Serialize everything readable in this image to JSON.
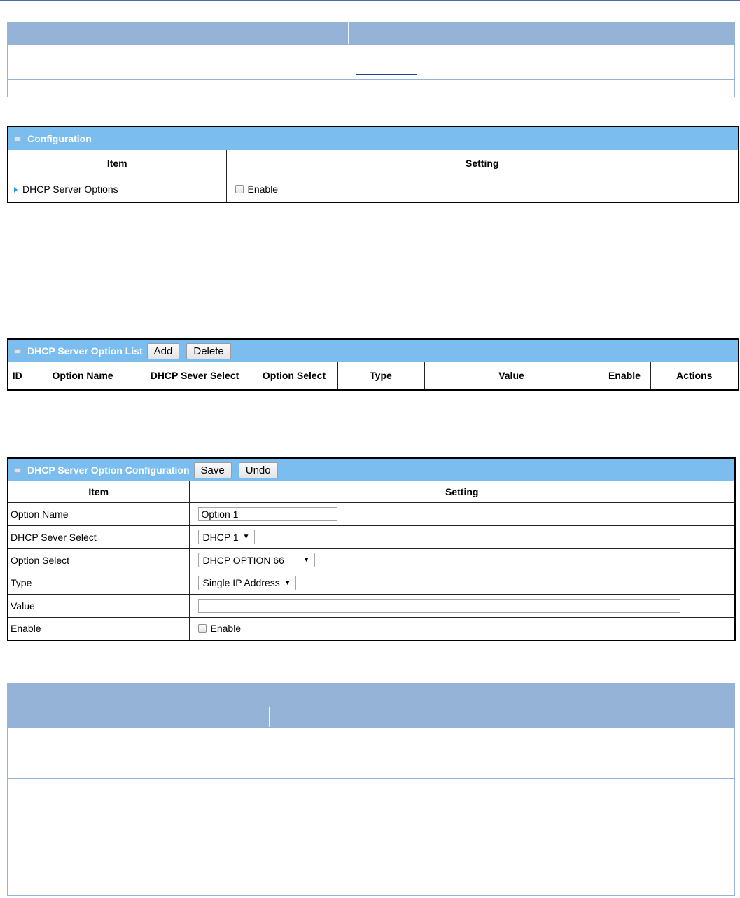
{
  "config_panel": {
    "title": "Configuration",
    "col_item": "Item",
    "col_setting": "Setting",
    "row_label": "DHCP Server Options",
    "enable_label": "Enable"
  },
  "list_panel": {
    "title": "DHCP Server Option List",
    "add_label": "Add",
    "delete_label": "Delete",
    "columns": [
      "ID",
      "Option Name",
      "DHCP Sever Select",
      "Option Select",
      "Type",
      "Value",
      "Enable",
      "Actions"
    ]
  },
  "option_config": {
    "title": "DHCP Server Option Configuration",
    "save_label": "Save",
    "undo_label": "Undo",
    "col_item": "Item",
    "col_setting": "Setting",
    "option_name_label": "Option Name",
    "option_name_value": "Option 1",
    "server_select_label": "DHCP Sever Select",
    "server_select_value": "DHCP 1",
    "option_select_label": "Option Select",
    "option_select_value": "DHCP OPTION 66",
    "type_label": "Type",
    "type_value": "Single IP Address",
    "value_label": "Value",
    "value_value": "",
    "enable_label": "Enable",
    "enable_checkbox_label": "Enable"
  },
  "colors": {
    "doc_table_header": "#95b3d7",
    "panel_bar": "#7abdee",
    "accent_triangle": "#2b9ad6"
  }
}
